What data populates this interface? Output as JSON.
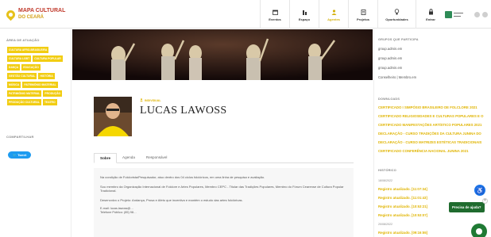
{
  "logo": {
    "line1": "MAPA CULTURAL",
    "line2": "DO CEARÁ"
  },
  "nav": [
    {
      "label": "Eventos",
      "icon": "calendar-icon"
    },
    {
      "label": "Espaço",
      "icon": "building-icon"
    },
    {
      "label": "Agentes",
      "icon": "person-icon",
      "active": true
    },
    {
      "label": "Projetos",
      "icon": "document-icon"
    },
    {
      "label": "Oportunidades",
      "icon": "lightbulb-icon"
    },
    {
      "label": "Entrar",
      "icon": "lock-icon"
    }
  ],
  "sidebar": {
    "area_title": "ÁREA DE ATUAÇÃO",
    "tags": [
      "CULTURA AFRO-BRASILEIRA",
      "CULTURA LGBT",
      "CULTURA POPULAR",
      "DANÇA",
      "EDUCAÇÃO",
      "GESTÃO CULTURAL",
      "HISTÓRIA",
      "MÚSICA",
      "PATRIMÔNIO IMATERIAL",
      "PATRIMÔNIO MATERIAL",
      "PRODUÇÃO",
      "PRODUÇÃO CULTURAL",
      "TEATRO"
    ],
    "share_title": "COMPARTILHAR",
    "tweet_label": "Tweet"
  },
  "profile": {
    "category": "INDIVIDUAL",
    "name": "LUCAS LAWOSS"
  },
  "tabs": [
    "Sobre",
    "Agenda",
    "Responsável"
  ],
  "description": {
    "p1": "Na condição de Folclorista/Pesquisador, atuo dentro dos 04 ciclos folclóricos, em uma linha de pesquisa e avaliação.",
    "p2": "Sou membro da Organização Internacional de Folclore e Artes Populares, Membro CEPC - Titular das Tradições Populares, Membro do Fórum Cearense de Cultura Popular Tradicional.",
    "p3": "Desenvolvo o Projeto: Andança, Prosa e Afeto que incentiva e mantém o estudo das artes folclóricas.",
    "email": "E-mail: lucas.lawoss@…",
    "phone": "Telefone Público: (85) 98…"
  },
  "right": {
    "groups_title": "GRUPOS QUE PARTICIPA",
    "groups": [
      "group.admin.em",
      "group.admin.em",
      "group.admin.em",
      "Conselheiro | Membro.em"
    ],
    "downloads_title": "DOWNLOADS",
    "downloads": [
      "CERTIFICADO I SIMPÓSIO BRASILEIRO DE FOLCLORE 2021",
      "CERTIFICADO RELIGIOSIDADES E CULTURAS POPULARES E O",
      "CERTIFICADO MANIFESTAÇÕES ARTÍSTICO POPULARES 2021",
      "DECLARAÇÃO - CURSO TRADIÇÕES DA CULTURA JUNINA DO",
      "DECLARAÇÃO - CURSO MATRIZES ESTÉTICAS TRADICIONAIS",
      "CERTIFICADO CONFERÊNCIA NACIONAL JUNINA 2021"
    ],
    "history_title": "HISTÓRICO",
    "history": [
      {
        "date": "18/08/2022",
        "entries": [
          "Registro atualizado. [11:07:34]",
          "Registro atualizado. [11:01:43]",
          "Registro atualizado. [10:53:21]",
          "Registro atualizado. [10:53:07]"
        ]
      },
      {
        "date": "20/08/2022",
        "entries": [
          "Registro atualizado. [09:16:55]"
        ]
      }
    ]
  },
  "help": {
    "bubble": "Precisa de ajuda?",
    "close": "×"
  },
  "colors": {
    "accent": "#f2cd12",
    "link": "#e0b400",
    "help_green": "#1f6b2e"
  }
}
